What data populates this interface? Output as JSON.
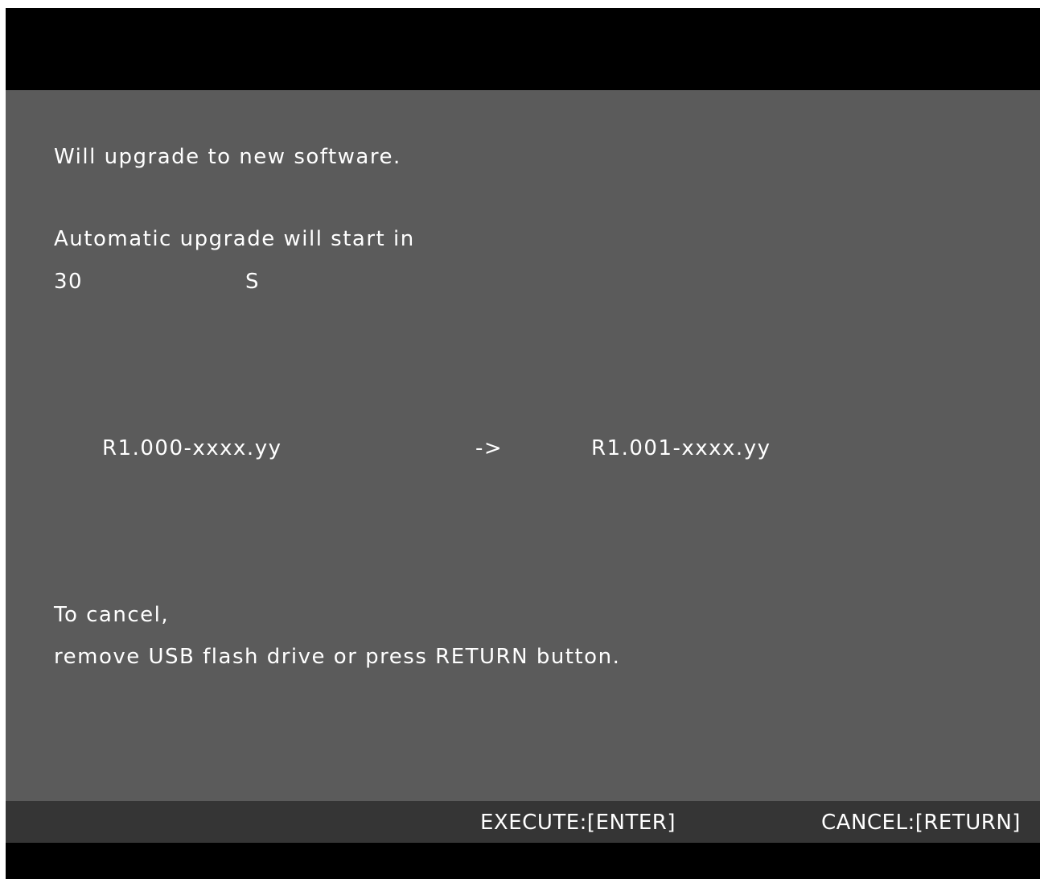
{
  "dialog": {
    "heading": "Will upgrade to new software.",
    "auto_start_text": "Automatic upgrade will start in",
    "countdown_value": "30",
    "countdown_unit": "S",
    "current_version": "R1.000-xxxx.yy",
    "arrow": "->",
    "new_version": "R1.001-xxxx.yy",
    "cancel_line1": "To cancel,",
    "cancel_line2": "remove USB flash drive or press RETURN button."
  },
  "footer": {
    "execute_label": "EXECUTE:[ENTER]",
    "cancel_label": "CANCEL:[RETURN]"
  },
  "colors": {
    "background": "#000000",
    "panel": "#5b5b5b",
    "footer": "#353535",
    "text": "#ffffff"
  }
}
